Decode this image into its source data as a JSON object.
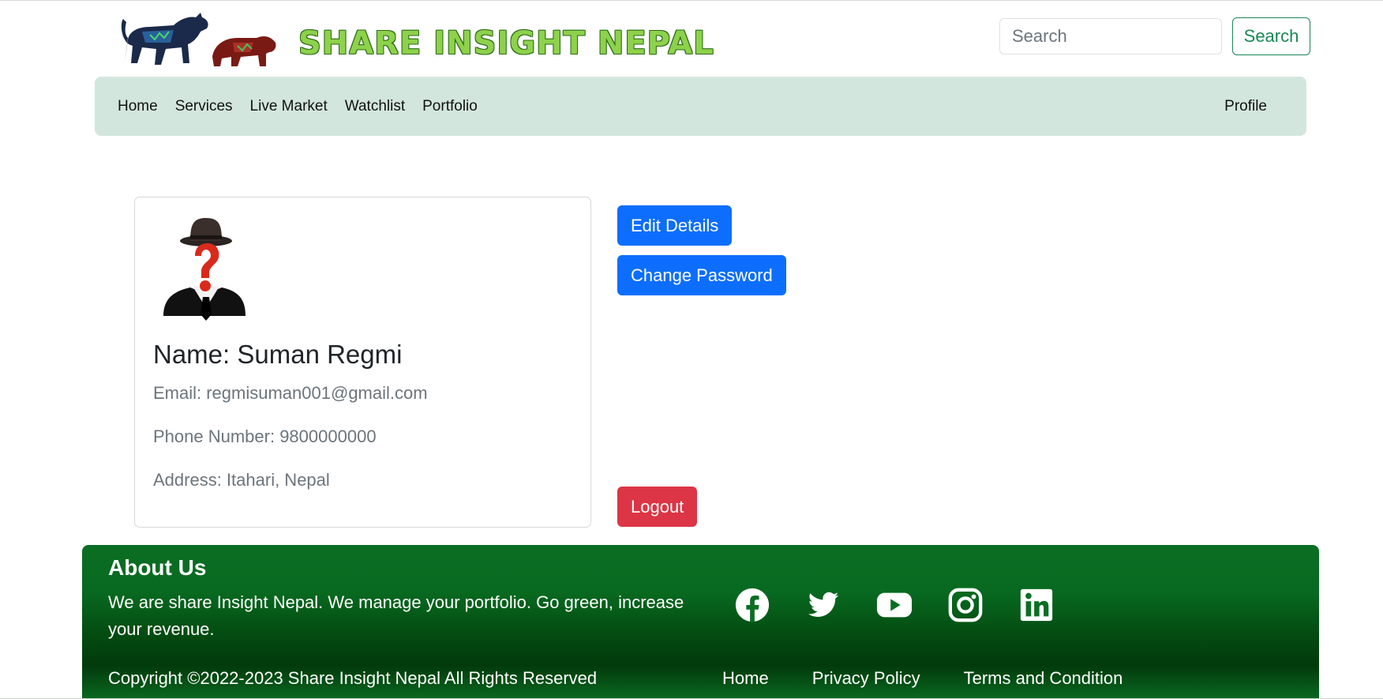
{
  "brand": {
    "logo_text": "SHARE INSIGHT NEPAL"
  },
  "search": {
    "placeholder": "Search",
    "button_label": "Search"
  },
  "nav": {
    "items": [
      {
        "label": "Home"
      },
      {
        "label": "Services"
      },
      {
        "label": "Live Market"
      },
      {
        "label": "Watchlist"
      },
      {
        "label": "Portfolio"
      }
    ],
    "profile_label": "Profile",
    "background": "#d3e6de"
  },
  "profile": {
    "name": "Name: Suman Regmi",
    "email": "Email: regmisuman001@gmail.com",
    "phone": "Phone Number: 9800000000",
    "address": "Address: Itahari, Nepal"
  },
  "actions": {
    "edit_label": "Edit Details",
    "change_password_label": "Change Password",
    "logout_label": "Logout"
  },
  "footer": {
    "about_title": "About Us",
    "about_text": "We are share Insight Nepal. We manage your portfolio. Go green, increase your revenue.",
    "social_icons": [
      "facebook-icon",
      "twitter-icon",
      "youtube-icon",
      "instagram-icon",
      "linkedin-icon"
    ],
    "copyright": "Copyright ©2022-2023 Share Insight Nepal All Rights Reserved",
    "links": [
      {
        "label": "Home"
      },
      {
        "label": "Privacy Policy"
      },
      {
        "label": "Terms and Condition"
      }
    ]
  },
  "colors": {
    "primary": "#0d6efd",
    "danger": "#dc3545",
    "success": "#198754",
    "footer_green": "#0a6e23"
  }
}
